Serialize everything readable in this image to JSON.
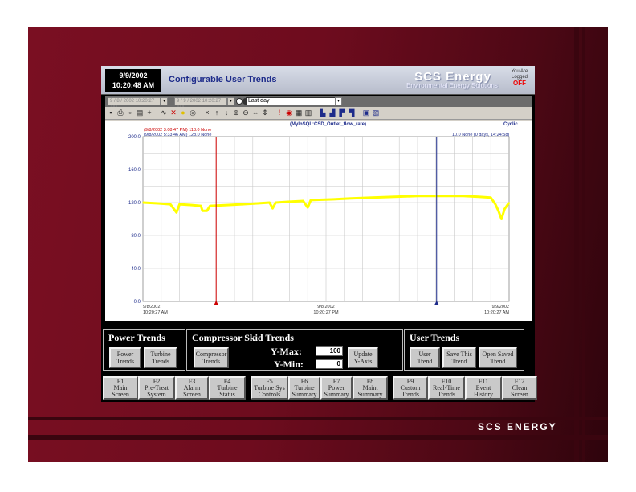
{
  "header": {
    "date": "9/9/2002",
    "time": "10:20:48 AM",
    "title": "Configurable User Trends",
    "brand_main": "SCS Energy",
    "brand_sub": "Environmental Energy Solutions",
    "logged_line1": "You Are",
    "logged_line2": "Logged",
    "logged_status": "OFF"
  },
  "selectors": {
    "start": "9 / 8 / 2002 10:20:27 AM",
    "end": "9 / 9 / 2002 10:20:27 AM",
    "period": "Last day"
  },
  "toolbar_icons": [
    "save-icon",
    "print-icon",
    "copy-icon",
    "paste-icon",
    "add-pen-icon",
    "chart-icon",
    "delete-pen-icon",
    "bulb-icon",
    "target-icon",
    "close-icon",
    "sort-up-icon",
    "sort-down-icon",
    "zoom-in-icon",
    "zoom-out-icon",
    "zoom-x-icon",
    "zoom-y-icon",
    "alarm-icon",
    "stop-icon",
    "grid-icon",
    "scale-icon",
    "bar1-icon",
    "bar2-icon",
    "bar3-icon",
    "bar4-icon",
    "legend-icon",
    "export-icon"
  ],
  "chart_header": {
    "pen_name": "(MyInSQL:CSD_Outlet_flow_rate)",
    "mode": "Cyclic",
    "cursor1": "(9/8/2002 3:08:47 PM)  118.0 None",
    "cursor2": "(9/8/2002 5:33:46 AM)  128.0 None",
    "cursor_diff": "10.0 None (0 days, 14:24:58)"
  },
  "chart_data": {
    "type": "line",
    "title": "(MyInSQL:CSD_Outlet_flow_rate)",
    "ylim": [
      0,
      200
    ],
    "yticks": [
      "200.0",
      "160.0",
      "120.0",
      "80.0",
      "40.0",
      "0.0"
    ],
    "ytick_values": [
      200,
      160,
      120,
      80,
      40,
      0
    ],
    "xticks": [
      {
        "date": "9/8/2002",
        "time": "10:20:27 AM",
        "h": 0
      },
      {
        "date": "9/8/2002",
        "time": "10:20:27 PM",
        "h": 12
      },
      {
        "date": "9/9/2002",
        "time": "10:20:27 AM",
        "h": 24
      }
    ],
    "xlim_hours": [
      0,
      24
    ],
    "grid": true,
    "series": [
      {
        "color": "#ffff00",
        "points": [
          [
            0,
            120
          ],
          [
            1,
            119
          ],
          [
            1.8,
            118
          ],
          [
            2.2,
            108
          ],
          [
            2.4,
            118
          ],
          [
            3.2,
            117
          ],
          [
            3.8,
            116
          ],
          [
            3.9,
            110
          ],
          [
            4.2,
            110
          ],
          [
            4.4,
            116
          ],
          [
            5.5,
            117
          ],
          [
            6.5,
            118
          ],
          [
            7.5,
            119
          ],
          [
            8.3,
            120
          ],
          [
            8.5,
            113
          ],
          [
            8.7,
            120
          ],
          [
            9.5,
            121
          ],
          [
            10.5,
            122
          ],
          [
            10.8,
            114
          ],
          [
            11,
            123
          ],
          [
            12.5,
            124
          ],
          [
            13.5,
            125
          ],
          [
            15,
            126
          ],
          [
            16.5,
            127
          ],
          [
            18,
            128
          ],
          [
            19.5,
            128
          ],
          [
            21,
            128
          ],
          [
            22,
            127
          ],
          [
            22.8,
            126
          ],
          [
            23.1,
            118
          ],
          [
            23.3,
            110
          ],
          [
            23.5,
            100
          ],
          [
            23.7,
            112
          ],
          [
            24,
            120
          ]
        ]
      }
    ],
    "cursors": [
      {
        "h": 4.8,
        "color": "#cc0000",
        "value": 118.0
      },
      {
        "h": 19.25,
        "color": "#1d2b8a",
        "value": 128.0
      }
    ]
  },
  "panels": {
    "power": {
      "title": "Power Trends",
      "btn1": [
        "Power",
        "Trends"
      ],
      "btn2": [
        "Turbine",
        "Trends"
      ]
    },
    "compressor": {
      "title": "Compressor Skid Trends",
      "btn1": [
        "Compressor",
        "Trends"
      ],
      "ymax_label": "Y-Max:",
      "ymax_value": "100",
      "ymin_label": "Y-Min:",
      "ymin_value": "0",
      "update": [
        "Update",
        "Y-Axis"
      ]
    },
    "user": {
      "title": "User Trends",
      "btn1": [
        "User",
        "Trend"
      ],
      "btn2": [
        "Save This",
        "Trend"
      ],
      "btn3": [
        "Open Saved",
        "Trend"
      ]
    }
  },
  "fkeys": [
    {
      "key": "F1",
      "l1": "Main",
      "l2": "Screen"
    },
    {
      "key": "F2",
      "l1": "Pre-Treat",
      "l2": "System"
    },
    {
      "key": "F3",
      "l1": "Alarm",
      "l2": "Screen"
    },
    {
      "key": "F4",
      "l1": "Turbine",
      "l2": "Status"
    },
    {
      "key": "F5",
      "l1": "Turbine Sys",
      "l2": "Controls"
    },
    {
      "key": "F6",
      "l1": "Turbine",
      "l2": "Summary"
    },
    {
      "key": "F7",
      "l1": "Power",
      "l2": "Summary"
    },
    {
      "key": "F8",
      "l1": "Maint",
      "l2": "Summary"
    },
    {
      "key": "F9",
      "l1": "Custom",
      "l2": "Trends"
    },
    {
      "key": "F10",
      "l1": "Real-Time",
      "l2": "Trends"
    },
    {
      "key": "F11",
      "l1": "Event",
      "l2": "History"
    },
    {
      "key": "F12",
      "l1": "Clean",
      "l2": "Screen"
    }
  ],
  "footer_brand": "SCS ENERGY",
  "colors": {
    "slide": "#6e0c1e",
    "trace": "#ffff00",
    "title_blue": "#1d2b8a"
  }
}
